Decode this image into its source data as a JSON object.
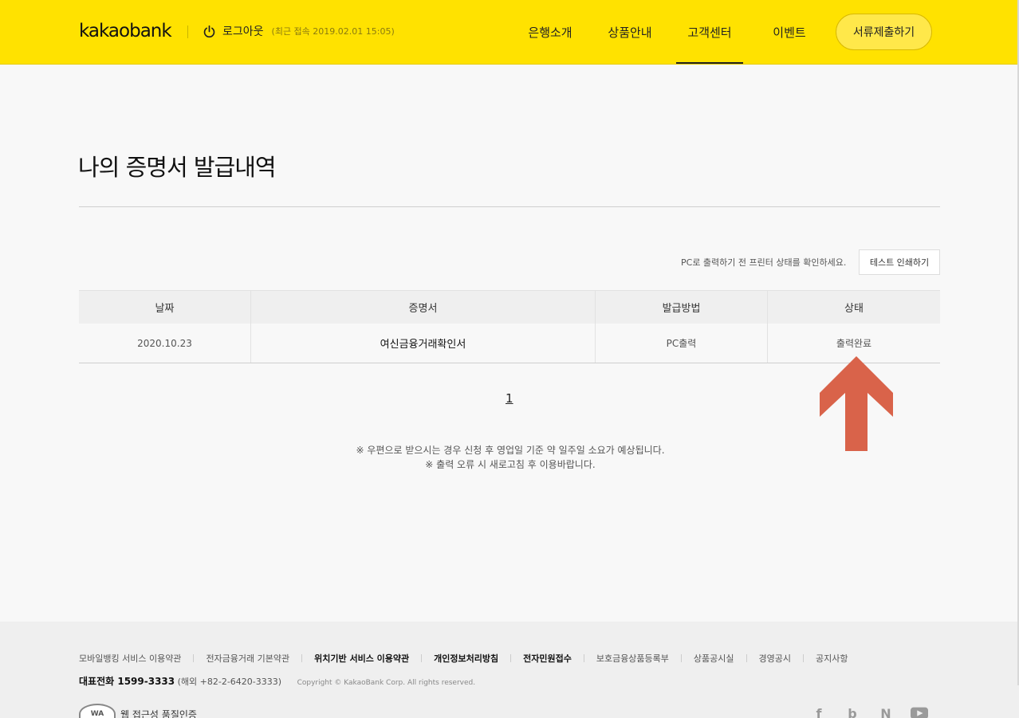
{
  "header": {
    "logo_text": "kakaobank",
    "logout_label": "로그아웃",
    "last_login": "(최근 접속 2019.02.01 15:05)",
    "nav": [
      "은행소개",
      "상품안내",
      "고객센터",
      "이벤트"
    ],
    "active_nav_index": 2,
    "submit_button": "서류제출하기",
    "brand_color": "#ffe200"
  },
  "main": {
    "title": "나의 증명서 발급내역",
    "print_note": "PC로 출력하기 전 프린터 상태를 확인하세요.",
    "test_print_button": "테스트 인쇄하기",
    "table": {
      "headers": [
        "날짜",
        "증명서",
        "발급방법",
        "상태"
      ],
      "rows": [
        [
          "2020.10.23",
          "여신금융거래확인서",
          "PC출력",
          "출력완료"
        ]
      ]
    },
    "pagination": {
      "current": "1"
    },
    "notice_lines": [
      "※ 우편으로 받으시는 경우 신청 후 영업일 기준 약 일주일 소요가 예상됩니다.",
      "※ 출력 오류 시 새로고침 후 이용바랍니다."
    ],
    "annotation_arrow_color": "#d9634a"
  },
  "footer": {
    "links": [
      {
        "label": "모바일뱅킹 서비스 이용약관",
        "bold": false
      },
      {
        "label": "전자금융거래 기본약관",
        "bold": false
      },
      {
        "label": "위치기반 서비스 이용약관",
        "bold": true
      },
      {
        "label": "개인정보처리방침",
        "bold": true
      },
      {
        "label": "전자민원접수",
        "bold": true
      },
      {
        "label": "보호금융상품등록부",
        "bold": false
      },
      {
        "label": "상품공시실",
        "bold": false
      },
      {
        "label": "경영공시",
        "bold": false
      },
      {
        "label": "공지사항",
        "bold": false
      }
    ],
    "phone_label": "대표전화 1599-3333",
    "phone_overseas": "(해외 +82-2-6420-3333)",
    "copyright": "Copyright © KakaoBank Corp. All rights reserved.",
    "cert_label": "웹 접근성 품질인증",
    "cert_logo_text": "WA",
    "social_icons": [
      "facebook-icon",
      "blog-icon",
      "naver-post-icon",
      "youtube-icon"
    ]
  }
}
